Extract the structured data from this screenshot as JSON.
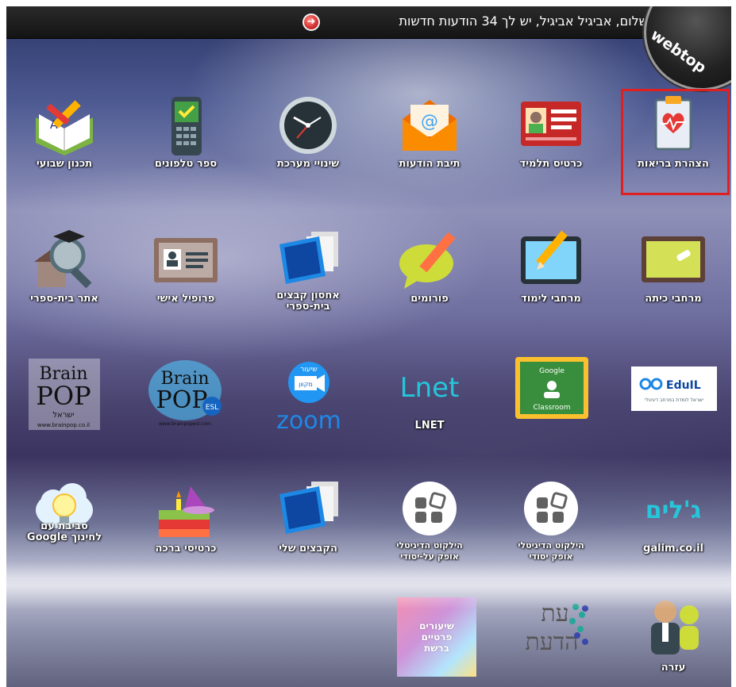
{
  "topbar": {
    "greeting": "שלום, אביגיל אביגיל, יש לך 34 הודעות חדשות",
    "brand": "webtop"
  },
  "apps": {
    "health": "הצהרת בריאות",
    "student_card": "כרטיס תלמיד",
    "mailbox": "תיבת הודעות",
    "system_change": "שינויי מערכת",
    "phonebook": "ספר טלפונים",
    "weekly_planner": "תכנון שבועי",
    "class_space": "מרחבי כיתה",
    "learning_space": "מרחבי לימוד",
    "forums": "פורומים",
    "school_files": "אחסון קבצים\nבית-ספרי",
    "profile": "פרופיל אישי",
    "school_site": "אתר בית-ספרי",
    "eduil": "EduIL",
    "eduil_sub": "ישראל לומדת במרחב דיגיטלי",
    "classroom_top": "Google",
    "classroom_bottom": "Classroom",
    "lnet_logo": "Lnet",
    "lnet": "LNET",
    "zoom_badge_top": "שיעור",
    "zoom_badge": "מקוון",
    "zoom": "zoom",
    "brainpop_esl": "Brain\nPOP",
    "brainpop_esl_badge": "ESL",
    "brainpop_esl_url": "www.brainpopesl.com",
    "brainpop": "Brain\nPOP",
    "brainpop_sub": "ישראל",
    "brainpop_url": "www.brainpop.co.il",
    "galim_logo": "ג'לים",
    "galim": "galim.co.il",
    "digital_bag_1": "הילקוט הדיגיטלי\nאופק יסודי",
    "digital_bag_2": "הילקוט הדיגיטלי\nאופק על-יסודי",
    "my_files": "הקבצים שלי",
    "greeting_cards": "כרטיסי ברכה",
    "google_env": "סביבת עם\nלחינוך Google",
    "help": "עזרה",
    "knowledge_time_1": "עת",
    "knowledge_time_2": "הדעת",
    "private_lessons": "שיעורים\nפרטיים\nברשת"
  }
}
